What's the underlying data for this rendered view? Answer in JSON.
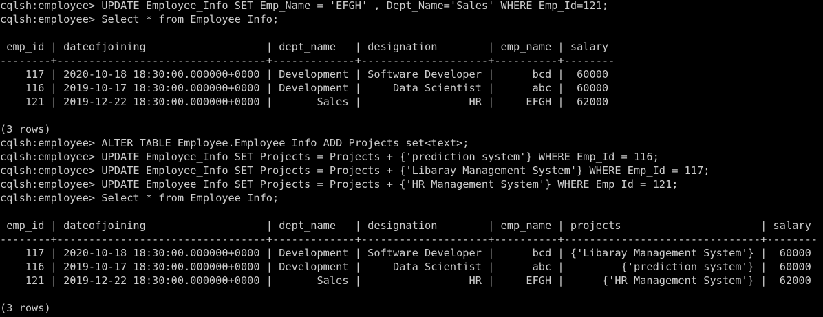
{
  "terminal": {
    "background": "#000000",
    "foreground": "#cccccc",
    "lines": [
      "cqlsh:employee> UPDATE Employee_Info SET Emp_Name = 'EFGH' , Dept_Name='Sales' WHERE Emp_Id=121;",
      "cqlsh:employee> Select * from Employee_Info;",
      "",
      " emp_id | dateofjoining                   | dept_name   | designation        | emp_name | salary",
      "--------+---------------------------------+-------------+--------------------+----------+--------",
      "    117 | 2020-10-18 18:30:00.000000+0000 | Development | Software Developer |      bcd |  60000",
      "    116 | 2019-10-17 18:30:00.000000+0000 | Development |     Data Scientist |      abc |  60000",
      "    121 | 2019-12-22 18:30:00.000000+0000 |       Sales |                 HR |     EFGH |  62000",
      "",
      "(3 rows)",
      "cqlsh:employee> ALTER TABLE Employee.Employee_Info ADD Projects set<text>;",
      "cqlsh:employee> UPDATE Employee_Info SET Projects = Projects + {'prediction system'} WHERE Emp_Id = 116;",
      "cqlsh:employee> UPDATE Employee_Info SET Projects = Projects + {'Libaray Management System'} WHERE Emp_Id = 117;",
      "cqlsh:employee> UPDATE Employee_Info SET Projects = Projects + {'HR Management System'} WHERE Emp_Id = 121;",
      "cqlsh:employee> Select * from Employee_Info;",
      "",
      " emp_id | dateofjoining                   | dept_name   | designation        | emp_name | projects                      | salary",
      "--------+---------------------------------+-------------+--------------------+----------+-------------------------------+--------",
      "    117 | 2020-10-18 18:30:00.000000+0000 | Development | Software Developer |      bcd | {'Libaray Management System'} |  60000",
      "    116 | 2019-10-17 18:30:00.000000+0000 | Development |     Data Scientist |      abc |         {'prediction system'} |  60000",
      "    121 | 2019-12-22 18:30:00.000000+0000 |       Sales |                 HR |     EFGH |      {'HR Management System'} |  62000",
      "",
      "(3 rows)"
    ]
  }
}
